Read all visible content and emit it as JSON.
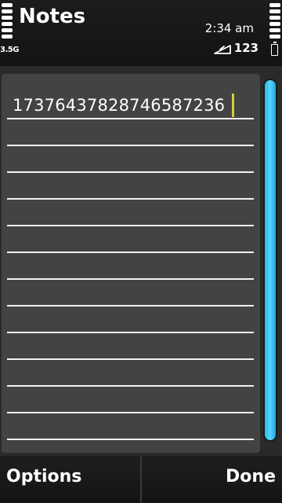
{
  "status_bar": {
    "app_title": "Notes",
    "time": "2:34 am",
    "network_type": "3.5G",
    "input_mode": "123",
    "icons": {
      "signal": "signal-strength-icon",
      "battery_level": "battery-level-icon",
      "battery": "battery-icon",
      "pen": "pen-input-icon"
    }
  },
  "note": {
    "text": "17376437828746587236",
    "line_count": 13
  },
  "softkeys": {
    "left_label": "Options",
    "right_label": "Done"
  },
  "colors": {
    "accent": "#2cb9ee",
    "cursor": "#d6cd3a",
    "panel": "#434343",
    "background": "#2a2a2a"
  }
}
